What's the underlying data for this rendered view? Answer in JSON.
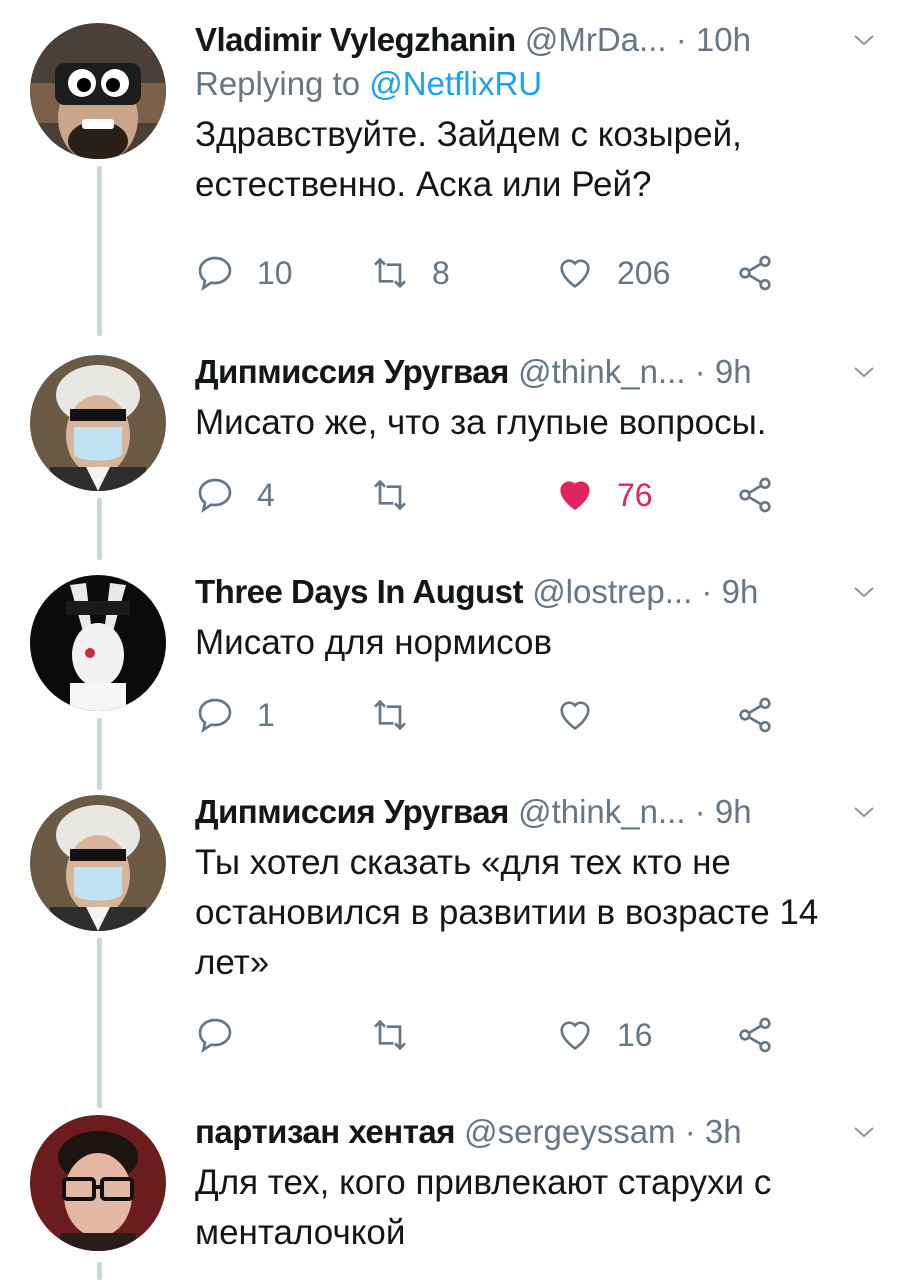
{
  "tweets": [
    {
      "name": "Vladimir Vylegzhanin",
      "handle": "@MrDa...",
      "time": "10h",
      "replying_label": "Replying to",
      "replying_to": "@NetflixRU",
      "text": "Здравствуйте. Зайдем с козырей, естественно. Аска или Рей?",
      "replies": "10",
      "retweets": "8",
      "likes": "206",
      "liked": false
    },
    {
      "name": "Дипмиссия Уругвая",
      "handle": "@think_n...",
      "time": "9h",
      "text": "Мисато же, что за глупые вопросы.",
      "replies": "4",
      "retweets": "",
      "likes": "76",
      "liked": true
    },
    {
      "name": "Three Days In August",
      "handle": "@lostrep...",
      "time": "9h",
      "text": "Мисато для нормисов",
      "replies": "1",
      "retweets": "",
      "likes": "",
      "liked": false
    },
    {
      "name": "Дипмиссия Уругвая",
      "handle": "@think_n...",
      "time": "9h",
      "text": "Ты хотел сказать «для тех кто не остановился в развитии в возрасте 14 лет»",
      "replies": "",
      "retweets": "",
      "likes": "16",
      "liked": false
    },
    {
      "name": "партизан хентая",
      "handle": "@sergeyssam",
      "time": "3h",
      "text": "Для тех, кого привлекают старухи с менталочкой"
    }
  ],
  "separator": "·",
  "colors": {
    "accent": "#1da1f2",
    "like_active": "#e0245e",
    "muted": "#657786",
    "thread_line": "#ccd6dd"
  },
  "icons": [
    "reply-icon",
    "retweet-icon",
    "like-icon",
    "share-icon",
    "chevron-down-icon"
  ]
}
